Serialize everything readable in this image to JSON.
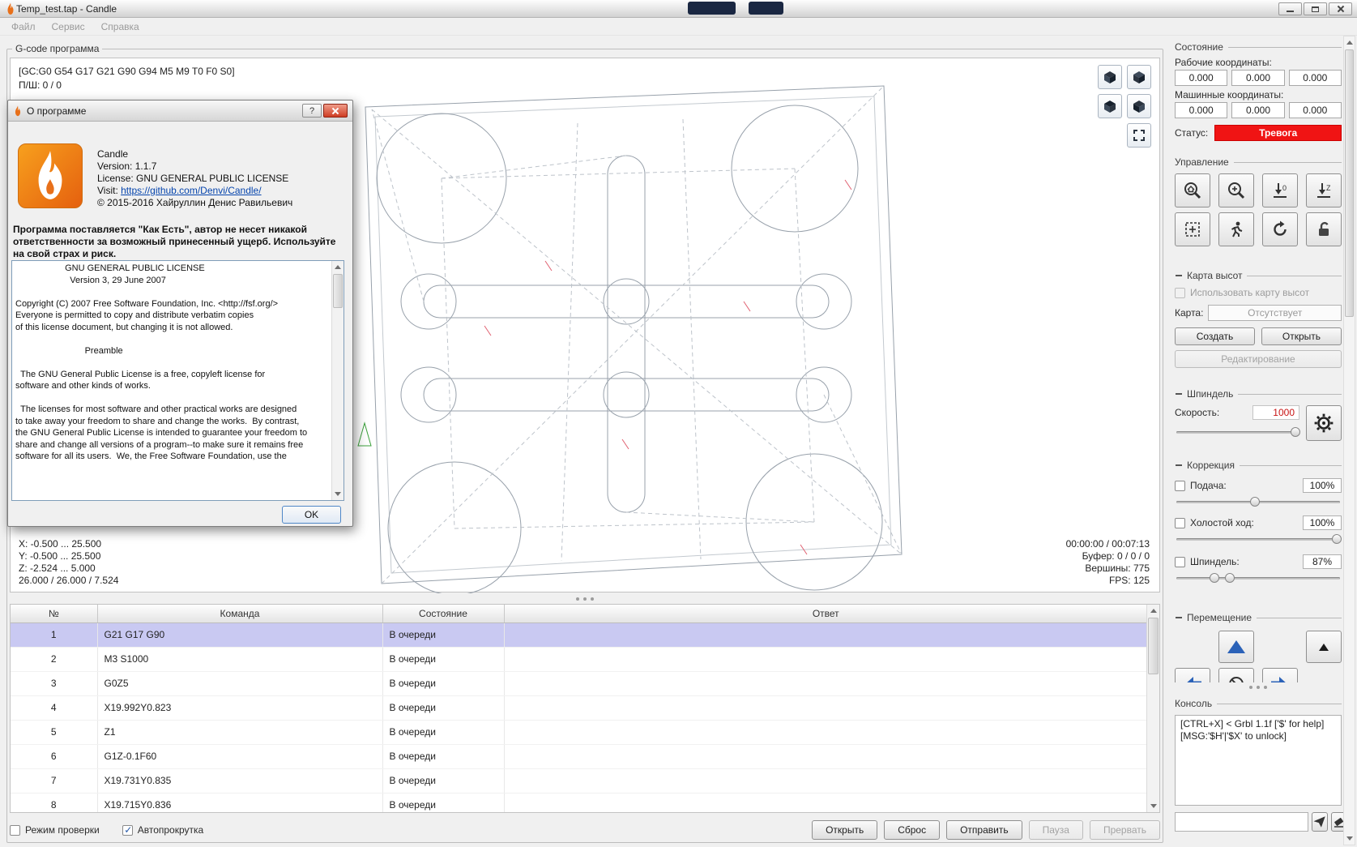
{
  "window": {
    "title": "Temp_test.tap - Candle"
  },
  "menu": {
    "items": [
      "Файл",
      "Сервис",
      "Справка"
    ]
  },
  "gcode_group": {
    "title": "G-code программа"
  },
  "viewport": {
    "parser_state": "[GC:G0 G54 G17 G21 G90 G94 M5 M9 T0 F0 S0]",
    "progress": "П/Ш: 0 / 0",
    "bounds": {
      "x": "X: -0.500 ... 25.500",
      "y": "Y: -0.500 ... 25.500",
      "z": "Z: -2.524 ... 5.000",
      "size": "26.000 / 26.000 / 7.524"
    },
    "stats": {
      "time": "00:00:00 / 00:07:13",
      "buffer": "Буфер: 0 / 0 / 0",
      "vertices": "Вершины: 775",
      "fps": "FPS: 125"
    }
  },
  "about_dialog": {
    "title": "О программе",
    "help_glyph": "?",
    "app_name": "Candle",
    "version": "Version: 1.1.7",
    "license_line": "License: GNU GENERAL PUBLIC LICENSE",
    "visit_prefix": "Visit: ",
    "visit_url": "https://github.com/Denvi/Candle/",
    "copyright": "© 2015-2016 Хайруллин Денис Равильевич",
    "disclaimer": "Программа поставляется \"Как Есть\", автор не несет никакой ответственности за возможный принесенный ущерб. Используйте на свой страх и риск.",
    "license_text": "                    GNU GENERAL PUBLIC LICENSE\n                      Version 3, 29 June 2007\n\nCopyright (C) 2007 Free Software Foundation, Inc. <http://fsf.org/>\nEveryone is permitted to copy and distribute verbatim copies\nof this license document, but changing it is not allowed.\n\n                            Preamble\n\n  The GNU General Public License is a free, copyleft license for\nsoftware and other kinds of works.\n\n  The licenses for most software and other practical works are designed\nto take away your freedom to share and change the works.  By contrast,\nthe GNU General Public License is intended to guarantee your freedom to\nshare and change all versions of a program--to make sure it remains free\nsoftware for all its users.  We, the Free Software Foundation, use the",
    "ok_button": "OK"
  },
  "table": {
    "columns": [
      "№",
      "Команда",
      "Состояние",
      "Ответ"
    ],
    "selected_index": 0,
    "rows": [
      {
        "num": "1",
        "command": "G21 G17 G90",
        "state": "В очереди",
        "response": ""
      },
      {
        "num": "2",
        "command": "M3 S1000",
        "state": "В очереди",
        "response": ""
      },
      {
        "num": "3",
        "command": "G0Z5",
        "state": "В очереди",
        "response": ""
      },
      {
        "num": "4",
        "command": "X19.992Y0.823",
        "state": "В очереди",
        "response": ""
      },
      {
        "num": "5",
        "command": "Z1",
        "state": "В очереди",
        "response": ""
      },
      {
        "num": "6",
        "command": "G1Z-0.1F60",
        "state": "В очереди",
        "response": ""
      },
      {
        "num": "7",
        "command": "X19.731Y0.835",
        "state": "В очереди",
        "response": ""
      },
      {
        "num": "8",
        "command": "X19.715Y0.836",
        "state": "В очереди",
        "response": ""
      }
    ]
  },
  "bottom_bar": {
    "check_mode": "Режим проверки",
    "autoscroll": "Автопрокрутка",
    "open": "Открыть",
    "reset": "Сброс",
    "send": "Отправить",
    "pause": "Пауза",
    "abort": "Прервать"
  },
  "state_panel": {
    "title": "Состояние",
    "work_label": "Рабочие координаты:",
    "work": [
      "0.000",
      "0.000",
      "0.000"
    ],
    "machine_label": "Машинные координаты:",
    "machine": [
      "0.000",
      "0.000",
      "0.000"
    ],
    "status_label": "Статус:",
    "status": "Тревога"
  },
  "control_panel": {
    "title": "Управление",
    "buttons": [
      "zoom-home",
      "zoom-search",
      "zero-xy",
      "zero-z",
      "restore-origin",
      "check-mode",
      "reset",
      "unlock"
    ]
  },
  "heightmap_panel": {
    "title": "Карта высот",
    "use_label": "Использовать карту высот",
    "map_label": "Карта:",
    "map_value": "Отсутствует",
    "create": "Создать",
    "open": "Открыть",
    "edit": "Редактирование"
  },
  "spindle_panel": {
    "title": "Шпиндель",
    "speed_label": "Скорость:",
    "speed_value": "1000"
  },
  "override_panel": {
    "title": "Коррекция",
    "feed_label": "Подача:",
    "feed_value": "100%",
    "rapid_label": "Холостой ход:",
    "rapid_value": "100%",
    "spindle_label": "Шпиндель:",
    "spindle_value": "87%"
  },
  "jog_panel": {
    "title": "Перемещение"
  },
  "console_panel": {
    "title": "Консоль",
    "log": "[CTRL+X] < Grbl 1.1f ['$' for help]\n[MSG:'$H'|'$X' to unlock]",
    "input_value": ""
  },
  "icons": {
    "flame-logo": "flame-shape",
    "view-cube": "isometric-cube",
    "fit-view": "expand-arrows",
    "zoom-home": "magnifier-home",
    "zoom-search": "magnifier-plus",
    "zero-xy": "arrow-down-zero",
    "zero-z": "arrow-down-z",
    "restore-origin": "dashed-square-cross",
    "check-mode": "running-man",
    "reset": "circular-arrow",
    "unlock": "open-padlock",
    "spindle-gear": "gear",
    "jog-up": "triangle-up-blue",
    "jog-step": "triangle-up-small",
    "jog-left": "arrow-left-blue",
    "jog-stop": "circle-slash",
    "jog-right": "arrow-right-blue",
    "send": "paper-plane",
    "clear": "eraser"
  },
  "colors": {
    "alarm": "#f01414",
    "selection": "#c9c9f2",
    "accent_blue": "#2b62b8",
    "link": "#0645ad",
    "logo_orange": "#e8701a",
    "speed_red": "#c81414"
  }
}
